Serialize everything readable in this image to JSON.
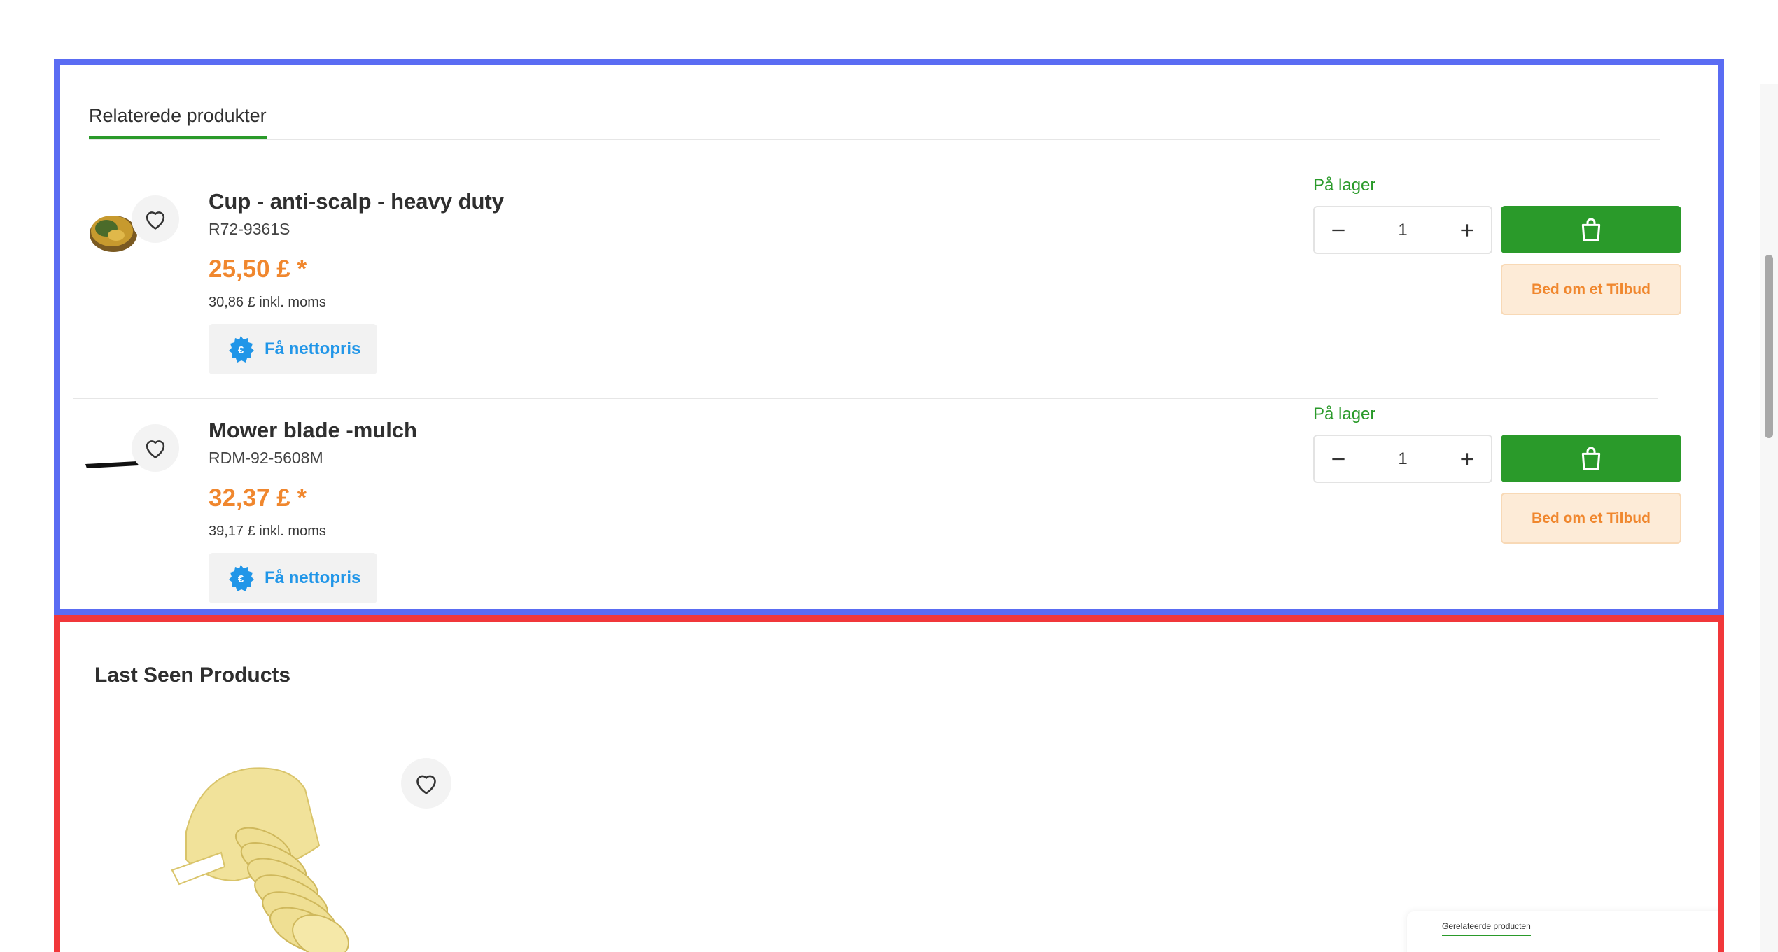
{
  "related": {
    "tab_label": "Relaterede produkter",
    "products": [
      {
        "name": "Cup - anti-scalp - heavy duty",
        "sku": "R72-9361S",
        "price": "25,50 £ *",
        "price_incl_vat": "30,86 £ inkl. moms",
        "net_price_label": "Få nettopris",
        "stock_status": "På lager",
        "quantity": "1",
        "offer_label": "Bed om et Tilbud"
      },
      {
        "name": "Mower blade -mulch",
        "sku": "RDM-92-5608M",
        "price": "32,37 £ *",
        "price_incl_vat": "39,17 £ inkl. moms",
        "net_price_label": "Få nettopris",
        "stock_status": "På lager",
        "quantity": "1",
        "offer_label": "Bed om et Tilbud"
      }
    ]
  },
  "last_seen": {
    "title": "Last Seen Products"
  },
  "mini_panel": {
    "tab_label": "Gerelateerde producten"
  },
  "colors": {
    "accent_green": "#2a9a2a",
    "price_orange": "#f0872e",
    "link_blue": "#2196e8",
    "offer_bg": "#fdebd7",
    "frame_blue": "#5a6cf3",
    "frame_red": "#f1373a"
  },
  "icons": {
    "favorite": "heart-outline-icon",
    "cart": "shopping-bag-icon",
    "decrease": "minus-icon",
    "increase": "plus-icon",
    "net_price": "euro-badge-icon"
  }
}
